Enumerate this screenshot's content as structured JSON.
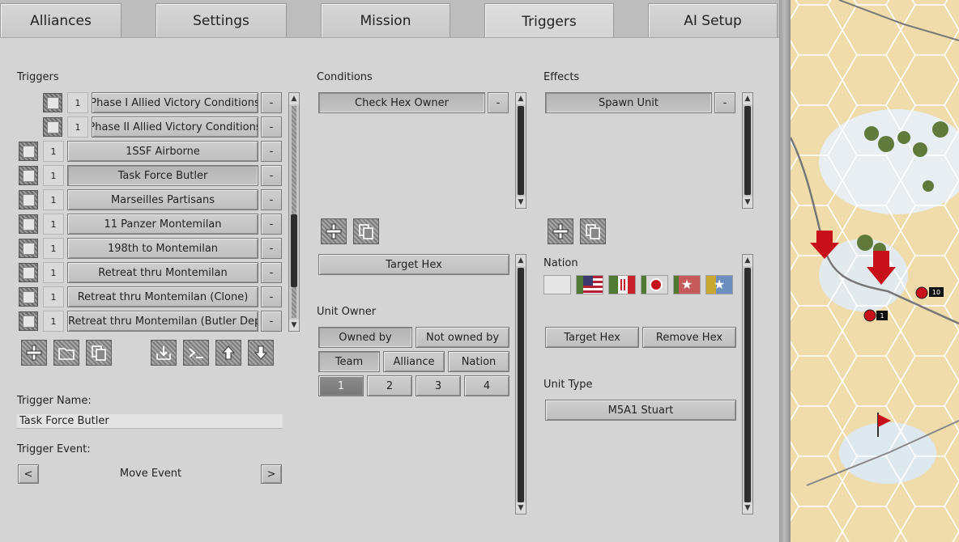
{
  "tabs": [
    {
      "label": "Alliances",
      "active": false
    },
    {
      "label": "Settings",
      "active": false
    },
    {
      "label": "Mission",
      "active": false
    },
    {
      "label": "Triggers",
      "active": true
    },
    {
      "label": "AI Setup",
      "active": false
    }
  ],
  "triggers": {
    "heading": "Triggers",
    "items": [
      {
        "count": "1",
        "label": "Phase I Allied Victory Conditions",
        "remove": "-"
      },
      {
        "count": "1",
        "label": "Phase II Allied Victory Conditions",
        "remove": "-"
      },
      {
        "count": "1",
        "label": "1SSF Airborne",
        "remove": "-"
      },
      {
        "count": "1",
        "label": "Task Force Butler",
        "remove": "-"
      },
      {
        "count": "1",
        "label": "Marseilles Partisans",
        "remove": "-"
      },
      {
        "count": "1",
        "label": "11 Panzer Montemilan",
        "remove": "-"
      },
      {
        "count": "1",
        "label": "198th to Montemilan",
        "remove": "-"
      },
      {
        "count": "1",
        "label": "Retreat thru Montemilan",
        "remove": "-"
      },
      {
        "count": "1",
        "label": "Retreat thru Montemilan (Clone)",
        "remove": "-"
      },
      {
        "count": "1",
        "label": "Retreat thru Montemilan (Butler Deploys)",
        "remove": "-"
      }
    ],
    "name_label": "Trigger Name:",
    "name_value": "Task Force Butler",
    "event_label": "Trigger Event:",
    "event_prev": "<",
    "event_value": "Move Event",
    "event_next": ">"
  },
  "conditions": {
    "heading": "Conditions",
    "items": [
      {
        "label": "Check Hex Owner",
        "remove": "-"
      }
    ],
    "target_hex": "Target Hex",
    "unit_owner_label": "Unit Owner",
    "owned_by": "Owned by",
    "not_owned_by": "Not owned by",
    "team": "Team",
    "alliance": "Alliance",
    "nation": "Nation",
    "numbers": [
      "1",
      "2",
      "3",
      "4"
    ],
    "selected_number": "1"
  },
  "effects": {
    "heading": "Effects",
    "items": [
      {
        "label": "Spawn Unit",
        "remove": "-"
      }
    ],
    "nation_label": "Nation",
    "target_hex": "Target Hex",
    "remove_hex": "Remove Hex",
    "unit_type_label": "Unit Type",
    "unit_type_value": "M5A1 Stuart"
  },
  "map": {
    "unit_badges": [
      "10",
      "1"
    ]
  },
  "colors": {
    "panel": "#d4d4d4",
    "map_sand": "#efdcaa",
    "arrow_red": "#c8101a"
  }
}
